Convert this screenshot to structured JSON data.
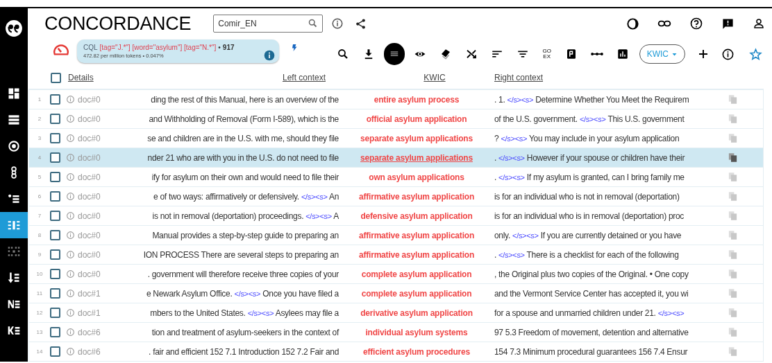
{
  "app": {
    "title": "CONCORDANCE",
    "corpus_field": {
      "value": "Comir_EN"
    }
  },
  "query": {
    "type": "CQL",
    "expression": "[tag=\"J.*\"] [word=\"asylum\"] [tag=\"N.*\"]",
    "separator": "•",
    "hits": "917",
    "stats": "472.82 per million tokens • 0.047%"
  },
  "sidebar": {
    "items": [
      {
        "kind": "dashboard",
        "selected": false
      },
      {
        "kind": "list",
        "selected": false
      },
      {
        "kind": "target",
        "selected": false
      },
      {
        "kind": "links",
        "selected": false
      },
      {
        "kind": "bullets",
        "selected": false
      },
      {
        "kind": "concordance",
        "selected": true
      },
      {
        "kind": "dots",
        "selected": false
      },
      {
        "kind": "sort",
        "selected": false
      },
      {
        "kind": "ne",
        "selected": false
      },
      {
        "kind": "ke",
        "selected": false
      }
    ]
  },
  "toolbar": {
    "tools": [
      {
        "kind": "search",
        "selected": false
      },
      {
        "kind": "download",
        "selected": false
      },
      {
        "kind": "view",
        "selected": true
      },
      {
        "kind": "eye",
        "selected": false
      },
      {
        "kind": "tag",
        "selected": false
      },
      {
        "kind": "shuffle",
        "selected": false
      },
      {
        "kind": "sort",
        "selected": false
      },
      {
        "kind": "filter",
        "selected": false
      },
      {
        "kind": "goex",
        "selected": false,
        "lines": [
          "GO",
          "EX"
        ]
      },
      {
        "kind": "doc",
        "selected": false
      },
      {
        "kind": "dots",
        "selected": false
      },
      {
        "kind": "chart",
        "selected": false
      }
    ],
    "view_menu": {
      "label": "KWIC"
    }
  },
  "table": {
    "select_all": {
      "checked": false
    },
    "columns": [
      "Details",
      "Left context",
      "KWIC",
      "Right context"
    ],
    "rows": [
      {
        "number": "1",
        "checked": false,
        "doc": "doc#0",
        "selected": false,
        "left": [
          {
            "kind": "text",
            "text": "ding the rest of this Manual, here is an overview of the"
          }
        ],
        "kwic": "entire asylum process",
        "right": [
          {
            "kind": "text",
            "text": ". 1."
          },
          {
            "kind": "tag",
            "text": "</s><s>"
          },
          {
            "kind": "text",
            "text": "Determine Whether You Meet the Requirem"
          }
        ]
      },
      {
        "number": "2",
        "checked": false,
        "doc": "doc#0",
        "selected": false,
        "left": [
          {
            "kind": "text",
            "text": "and Withholding of Removal (Form I-589), which is the"
          }
        ],
        "kwic": "official asylum application",
        "right": [
          {
            "kind": "text",
            "text": "of the U.S. government."
          },
          {
            "kind": "tag",
            "text": "</s><s>"
          },
          {
            "kind": "text",
            "text": "This U.S. government"
          }
        ]
      },
      {
        "number": "3",
        "checked": false,
        "doc": "doc#0",
        "selected": false,
        "left": [
          {
            "kind": "text",
            "text": "se and children are in the U.S. with me, should they file"
          }
        ],
        "kwic": "separate asylum applications",
        "right": [
          {
            "kind": "text",
            "text": "?"
          },
          {
            "kind": "tag",
            "text": "</s><s>"
          },
          {
            "kind": "text",
            "text": "You may include in your asylum application"
          }
        ]
      },
      {
        "number": "4",
        "checked": false,
        "doc": "doc#0",
        "selected": true,
        "left": [
          {
            "kind": "text",
            "text": "nder 21 who are with you in the U.S. do not need to file"
          }
        ],
        "kwic": "separate asylum applications",
        "right": [
          {
            "kind": "text",
            "text": "."
          },
          {
            "kind": "tag",
            "text": "</s><s>"
          },
          {
            "kind": "text",
            "text": "However if your spouse or children have their"
          }
        ]
      },
      {
        "number": "5",
        "checked": false,
        "doc": "doc#0",
        "selected": false,
        "left": [
          {
            "kind": "text",
            "text": "ify for asylum on their own and would need to file their"
          }
        ],
        "kwic": "own asylum applications",
        "right": [
          {
            "kind": "text",
            "text": "."
          },
          {
            "kind": "tag",
            "text": "</s><s>"
          },
          {
            "kind": "text",
            "text": "If my asylum is granted, can I bring family me"
          }
        ]
      },
      {
        "number": "6",
        "checked": false,
        "doc": "doc#0",
        "selected": false,
        "left": [
          {
            "kind": "text",
            "text": "e of two ways: affirmatively or defensively."
          },
          {
            "kind": "tag",
            "text": "</s><s>"
          },
          {
            "kind": "text",
            "text": "An"
          }
        ],
        "kwic": "affirmative asylum application",
        "right": [
          {
            "kind": "text",
            "text": "is for an individual who is not in removal (deportation)"
          }
        ]
      },
      {
        "number": "7",
        "checked": false,
        "doc": "doc#0",
        "selected": false,
        "left": [
          {
            "kind": "text",
            "text": "is not in removal (deportation) proceedings."
          },
          {
            "kind": "tag",
            "text": "</s><s>"
          },
          {
            "kind": "text",
            "text": "A"
          }
        ],
        "kwic": "defensive asylum application",
        "right": [
          {
            "kind": "text",
            "text": "is for an individual who is in removal (deportation) proc"
          }
        ]
      },
      {
        "number": "8",
        "checked": false,
        "doc": "doc#0",
        "selected": false,
        "left": [
          {
            "kind": "text",
            "text": "Manual provides a step-by-step guide to preparing an"
          }
        ],
        "kwic": "affirmative asylum application",
        "right": [
          {
            "kind": "text",
            "text": "only."
          },
          {
            "kind": "tag",
            "text": "</s><s>"
          },
          {
            "kind": "text",
            "text": "If you are currently detained or you have"
          }
        ]
      },
      {
        "number": "9",
        "checked": false,
        "doc": "doc#0",
        "selected": false,
        "left": [
          {
            "kind": "text",
            "text": "ION PROCESS There are several steps to preparing an"
          }
        ],
        "kwic": "affirmative asylum application",
        "right": [
          {
            "kind": "text",
            "text": "."
          },
          {
            "kind": "tag",
            "text": "</s><s>"
          },
          {
            "kind": "text",
            "text": "There is a checklist for each of the following"
          }
        ]
      },
      {
        "number": "10",
        "checked": false,
        "doc": "doc#0",
        "selected": false,
        "left": [
          {
            "kind": "text",
            "text": ". government will therefore receive three copies of your"
          }
        ],
        "kwic": "complete asylum application",
        "right": [
          {
            "kind": "text",
            "text": ", the Original plus two copies of the Original. • One copy"
          }
        ]
      },
      {
        "number": "11",
        "checked": false,
        "doc": "doc#1",
        "selected": false,
        "left": [
          {
            "kind": "text",
            "text": "e Newark Asylum Office."
          },
          {
            "kind": "tag",
            "text": "</s><s>"
          },
          {
            "kind": "text",
            "text": "Once you have filed a"
          }
        ],
        "kwic": "complete asylum application",
        "right": [
          {
            "kind": "text",
            "text": "and the Vermont Service Center has accepted it, you wi"
          }
        ]
      },
      {
        "number": "12",
        "checked": false,
        "doc": "doc#1",
        "selected": false,
        "left": [
          {
            "kind": "text",
            "text": "mbers to the United States."
          },
          {
            "kind": "tag",
            "text": "</s><s>"
          },
          {
            "kind": "text",
            "text": "Asylees may file a"
          }
        ],
        "kwic": "derivative asylum application",
        "right": [
          {
            "kind": "text",
            "text": "for a spouse and unmarried children under 21."
          },
          {
            "kind": "tag",
            "text": "</s><s>"
          }
        ]
      },
      {
        "number": "13",
        "checked": false,
        "doc": "doc#6",
        "selected": false,
        "left": [
          {
            "kind": "text",
            "text": "tion and treatment of asylum-seekers in the context of"
          }
        ],
        "kwic": "individual asylum systems",
        "right": [
          {
            "kind": "text",
            "text": "97 5.3 Freedom of movement, detention and alternative"
          }
        ]
      },
      {
        "number": "14",
        "checked": false,
        "doc": "doc#6",
        "selected": false,
        "left": [
          {
            "kind": "text",
            "text": ". fair and efficient 152 7.1 Introduction 152 7.2 Fair and"
          }
        ],
        "kwic": "efficient asylum procedures",
        "right": [
          {
            "kind": "text",
            "text": "154 7.3 Minimum procedural guarantees 156 7.4 Ensur"
          }
        ]
      }
    ]
  }
}
